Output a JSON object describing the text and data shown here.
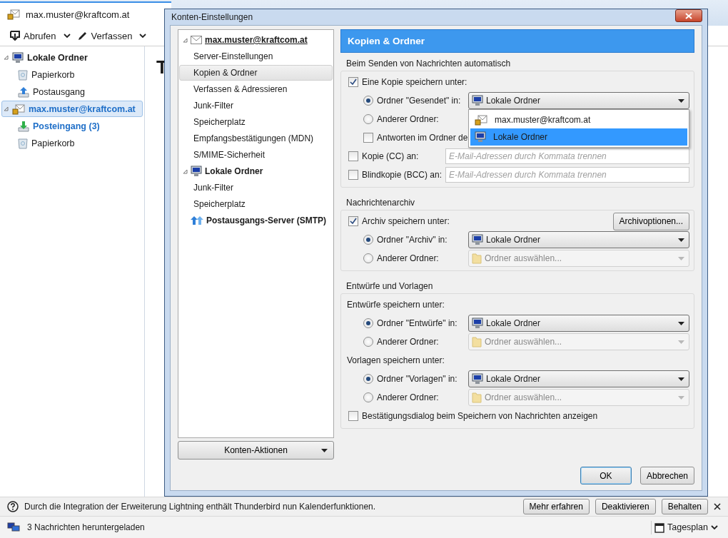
{
  "app_tab": {
    "title": "max.muster@kraftcom.at"
  },
  "toolbar": {
    "buttons": [
      {
        "label": "Abrufen",
        "kind": "fetch"
      },
      {
        "label": "Verfassen",
        "kind": "compose"
      }
    ]
  },
  "folder_tree": [
    {
      "label": "Lokale Ordner",
      "kind": "local",
      "selected": false,
      "unread": false,
      "children": [
        {
          "label": "Papierkorb",
          "kind": "trash",
          "selected": false,
          "unread": false
        },
        {
          "label": "Postausgang",
          "kind": "outbox",
          "selected": false,
          "unread": false
        }
      ]
    },
    {
      "label": "max.muster@kraftcom.at",
      "kind": "account",
      "selected": true,
      "unread": true,
      "children": [
        {
          "label": "Posteingang (3)",
          "kind": "inbox",
          "selected": false,
          "unread": true
        },
        {
          "label": "Papierkorb",
          "kind": "trash",
          "selected": false,
          "unread": false
        }
      ]
    }
  ],
  "main_heading": "T",
  "notification": {
    "text": "Durch die Integration der Erweiterung Lightning enthält Thunderbird nun Kalenderfunktionen.",
    "buttons": [
      "Mehr erfahren",
      "Deaktivieren",
      "Behalten"
    ]
  },
  "status_bar": {
    "text": "3 Nachrichten heruntergeladen",
    "calendar_button": "Tagesplan"
  },
  "dialog": {
    "title": "Konten-Einstellungen",
    "nav": [
      {
        "label": "max.muster@kraftcom.at",
        "kind": "account",
        "children": [
          {
            "label": "Server-Einstellungen",
            "selected": false
          },
          {
            "label": "Kopien & Ordner",
            "selected": true
          },
          {
            "label": "Verfassen & Adressieren",
            "selected": false
          },
          {
            "label": "Junk-Filter",
            "selected": false
          },
          {
            "label": "Speicherplatz",
            "selected": false
          },
          {
            "label": "Empfangsbestätigungen (MDN)",
            "selected": false
          },
          {
            "label": "S/MIME-Sicherheit",
            "selected": false
          }
        ]
      },
      {
        "label": "Lokale Ordner",
        "kind": "local",
        "children": [
          {
            "label": "Junk-Filter",
            "selected": false
          },
          {
            "label": "Speicherplatz",
            "selected": false
          }
        ]
      },
      {
        "label": "Postausgangs-Server (SMTP)",
        "kind": "smtp"
      }
    ],
    "account_actions": "Konten-Aktionen",
    "page_title": "Kopien & Ordner",
    "sections": [
      {
        "legend": "Beim Senden von Nachrichten automatisch",
        "rows": [
          {
            "kind": "checkbox",
            "label": "Eine Kopie speichern unter:",
            "checked": true
          },
          {
            "kind": "radio",
            "label": "Ordner \"Gesendet\" in:",
            "selected": true,
            "select": {
              "value": "Lokale Ordner",
              "kind": "local",
              "disabled": false,
              "options": [
                {
                  "label": "max.muster@kraftcom.at",
                  "kind": "account",
                  "selected": false
                },
                {
                  "label": "Lokale Ordner",
                  "kind": "local",
                  "selected": true
                }
              ]
            }
          },
          {
            "kind": "radio",
            "label": "Anderer Ordner:",
            "selected": false
          },
          {
            "kind": "subcheckbox",
            "label": "Antworten im Ordner de",
            "checked": false
          },
          {
            "kind": "email",
            "label": "Kopie (CC) an:",
            "checked": false,
            "placeholder": "E-Mail-Adressen durch Kommata trennen"
          },
          {
            "kind": "email",
            "label": "Blindkopie (BCC) an:",
            "checked": false,
            "placeholder": "E-Mail-Adressen durch Kommata trennen"
          }
        ]
      },
      {
        "legend": "Nachrichtenarchiv",
        "rows": [
          {
            "kind": "checkbox",
            "label": "Archiv speichern unter:",
            "checked": true,
            "button": "Archivoptionen..."
          },
          {
            "kind": "radio",
            "label": "Ordner \"Archiv\" in:",
            "selected": true,
            "select": {
              "value": "Lokale Ordner",
              "kind": "local",
              "disabled": false
            }
          },
          {
            "kind": "radio",
            "label": "Anderer Ordner:",
            "selected": false,
            "select": {
              "value": "Ordner auswählen...",
              "kind": "folder",
              "disabled": true
            }
          }
        ]
      },
      {
        "legend": "Entwürfe und Vorlagen",
        "rows": [
          {
            "kind": "heading",
            "label": "Entwürfe speichern unter:"
          },
          {
            "kind": "radio",
            "label": "Ordner \"Entwürfe\" in:",
            "selected": true,
            "select": {
              "value": "Lokale Ordner",
              "kind": "local",
              "disabled": false
            }
          },
          {
            "kind": "radio",
            "label": "Anderer Ordner:",
            "selected": false,
            "select": {
              "value": "Ordner auswählen...",
              "kind": "folder",
              "disabled": true
            }
          },
          {
            "kind": "heading",
            "label": "Vorlagen speichern unter:"
          },
          {
            "kind": "radio",
            "label": "Ordner \"Vorlagen\" in:",
            "selected": true,
            "select": {
              "value": "Lokale Ordner",
              "kind": "local",
              "disabled": false
            }
          },
          {
            "kind": "radio",
            "label": "Anderer Ordner:",
            "selected": false,
            "select": {
              "value": "Ordner auswählen...",
              "kind": "folder",
              "disabled": true
            }
          },
          {
            "kind": "checkbox",
            "label": "Bestätigungsdialog beim Speichern von Nachrichten anzeigen",
            "checked": false
          }
        ]
      }
    ],
    "buttons": [
      {
        "label": "OK",
        "default": true
      },
      {
        "label": "Abbrechen",
        "default": false
      }
    ]
  }
}
